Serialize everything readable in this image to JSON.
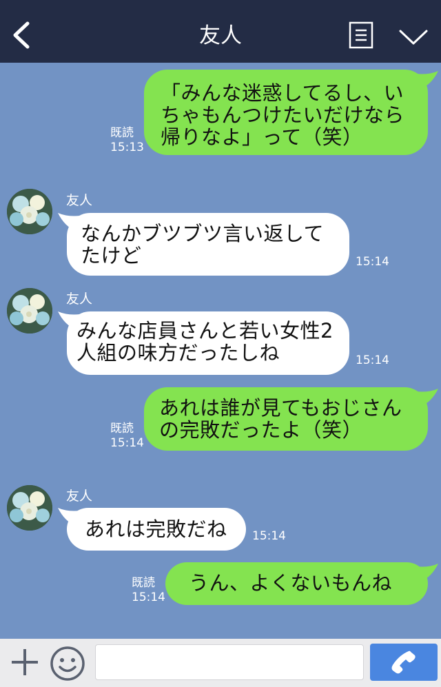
{
  "header": {
    "title": "友人"
  },
  "chat": {
    "messages": [
      {
        "side": "me",
        "text": "「みんな迷惑してるし、い\nちゃもんつけたいだけなら\n帰りなよ」って（笑）",
        "read": "既読",
        "time": "15:13"
      },
      {
        "side": "friend",
        "name": "友人",
        "text": "なんかブツブツ言い返して\nたけど",
        "time": "15:14"
      },
      {
        "side": "friend",
        "name": "友人",
        "text": "みんな店員さんと若い女性2\n人組の味方だったしね",
        "time": "15:14"
      },
      {
        "side": "me",
        "text": "あれは誰が見てもおじさん\nの完敗だったよ（笑）",
        "read": "既読",
        "time": "15:14"
      },
      {
        "side": "friend",
        "name": "友人",
        "text": "あれは完敗だね",
        "time": "15:14"
      },
      {
        "side": "me",
        "text": "うん、よくないもんね",
        "read": "既読",
        "time": "15:14"
      }
    ]
  },
  "input": {
    "placeholder": ""
  },
  "colors": {
    "my_bubble": "#84e350",
    "friend_bubble": "#ffffff",
    "background": "#7293c4",
    "header": "#232c45",
    "call_button": "#4a86e0"
  },
  "icons": {
    "back": "chevron-left-icon",
    "memo": "notes-icon",
    "menu": "chevron-down-icon",
    "add": "plus-icon",
    "sticker": "smiley-icon",
    "call": "phone-icon"
  }
}
